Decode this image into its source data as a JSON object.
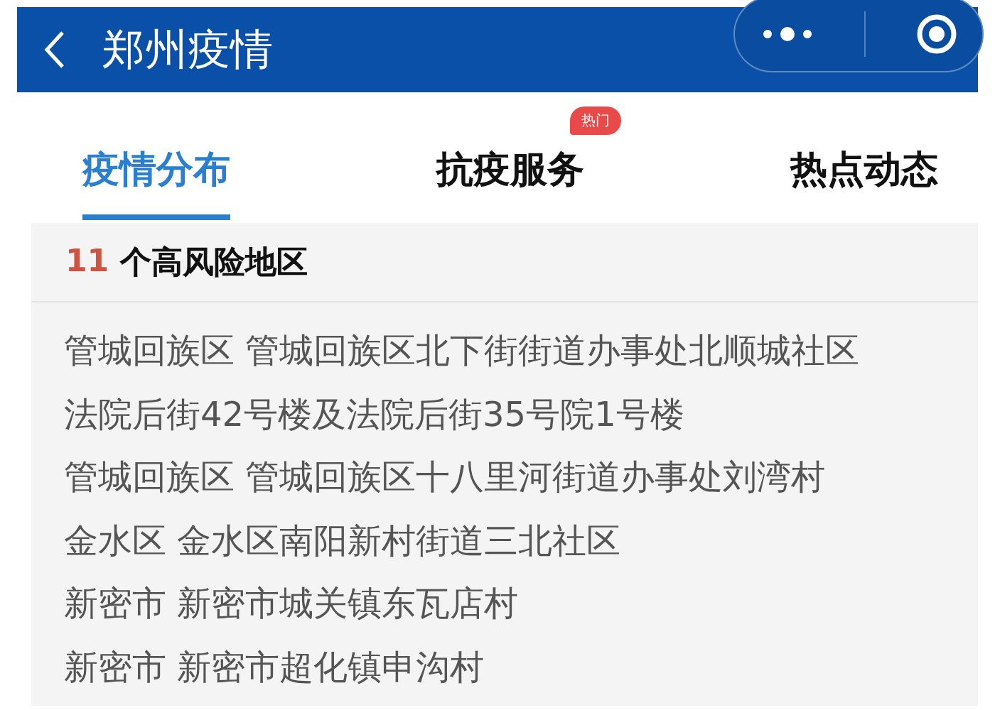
{
  "header": {
    "title": "郑州疫情"
  },
  "tabs": [
    {
      "label": "疫情分布",
      "selected": true
    },
    {
      "label": "抗疫服务",
      "selected": false,
      "badge": "热门"
    },
    {
      "label": "热点动态",
      "selected": false
    }
  ],
  "risk_panel": {
    "count": "11",
    "title": "个高风险地区",
    "rows": [
      "管城回族区 管城回族区北下街街道办事处北顺城社区",
      "法院后街42号楼及法院后街35号院1号楼",
      "管城回族区 管城回族区十八里河街道办事处刘湾村",
      "金水区 金水区南阳新村街道三北社区",
      "新密市 新密市城关镇东瓦店村",
      "新密市 新密市超化镇申沟村"
    ]
  }
}
